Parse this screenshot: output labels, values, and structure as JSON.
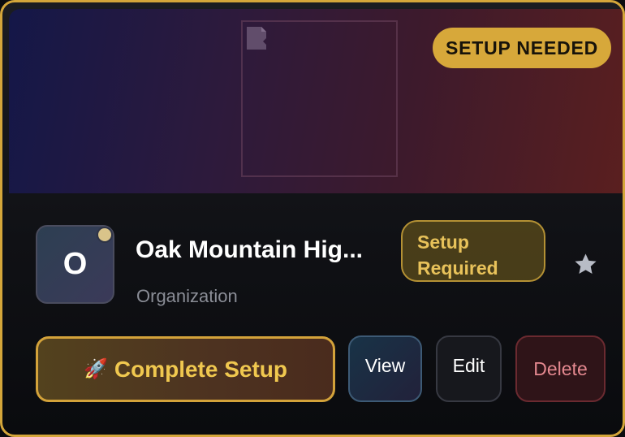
{
  "banner": {
    "status_badge": "SETUP NEEDED"
  },
  "organization": {
    "avatar_initial": "O",
    "name": "Oak Mountain Hig...",
    "type": "Organization",
    "status_badge_line1": "Setup",
    "status_badge_line2": "Required",
    "favorite_icon": "star-icon"
  },
  "actions": {
    "complete_setup_emoji": "🚀",
    "complete_setup_label": "Complete Setup",
    "view_label": "View",
    "edit_label": "Edit",
    "delete_label": "Delete"
  },
  "colors": {
    "accent_gold": "#d4a63a",
    "delete_text": "#e4888f",
    "star": "#b8bcc6"
  }
}
